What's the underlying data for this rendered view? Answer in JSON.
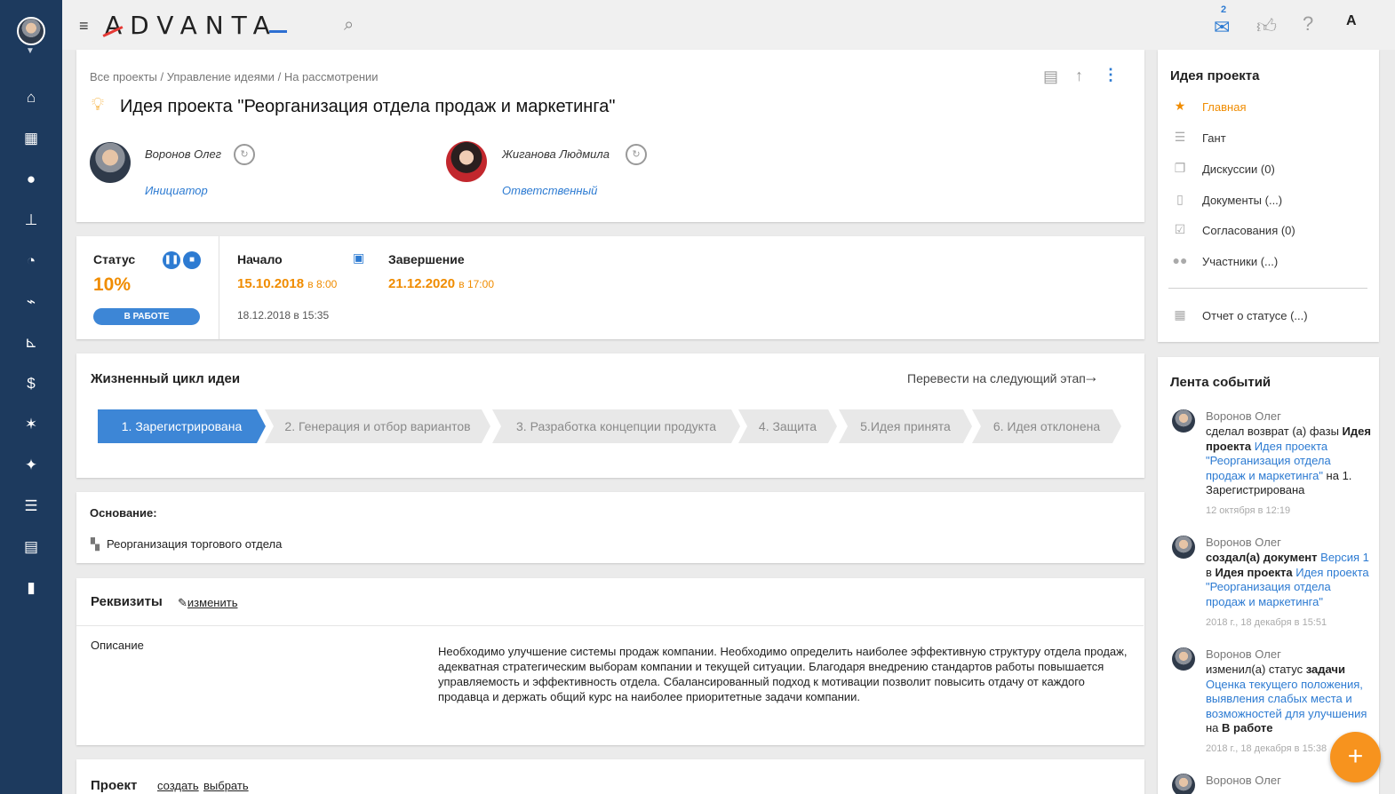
{
  "nav": {
    "icons": [
      "home-icon",
      "calendar-icon",
      "contacts-icon",
      "org-structure-icon",
      "analytics-pie-icon",
      "statistics-icon",
      "reports-icon",
      "finance-icon",
      "activity-icon",
      "ideas-sparkle-icon",
      "tasks-icon",
      "news-icon",
      "bookmark-icon"
    ]
  },
  "topbar": {
    "logo": "ADVANTA",
    "mail_count": "2",
    "user_initial": "A"
  },
  "header": {
    "breadcrumb": [
      {
        "label": "Все проекты"
      },
      {
        "label": "Управление идеями"
      },
      {
        "label": "На рассмотрении"
      }
    ],
    "breadcrumb_sep": "/",
    "title": "Идея проекта \"Реорганизация отдела продаж и маркетинга\"",
    "initiator": {
      "name": "Воронов Олег",
      "role": "Инициатор"
    },
    "responsible": {
      "name": "Жиганова Людмила",
      "role": "Ответственный"
    }
  },
  "status": {
    "label": "Статус",
    "value": "10%",
    "badge": "В РАБОТЕ",
    "start_label": "Начало",
    "start_date": "15.10.2018",
    "start_time": "в 8:00",
    "end_label": "Завершение",
    "end_date": "21.12.2020",
    "end_time": "в 17:00",
    "created": "18.12.2018 в 15:35"
  },
  "lifecycle": {
    "title": "Жизненный цикл идеи",
    "next_label": "Перевести на следующий этап",
    "stages": [
      "1. Зарегистрирована",
      "2. Генерация и отбор вариантов",
      "3. Разработка концепции продукта",
      "4. Защита",
      "5.Идея принята",
      "6. Идея отклонена"
    ],
    "active_index": 0
  },
  "basis": {
    "label": "Основание:",
    "link": "Реорганизация торгового отдела"
  },
  "requisites": {
    "title": "Реквизиты",
    "edit": "изменить",
    "desc_label": "Описание",
    "desc_text": "Необходимо улучшение системы продаж компании. Необходимо определить наиболее эффективную структуру отдела продаж, адекватная стратегическим выборам компании и текущей ситуации. Благодаря внедрению стандартов работы повышается управляемость и эффективность отдела. Сбалансированный подход к мотивации позволит повысить отдачу от каждого продавца и держать общий курс на наиболее приоритетные задачи компании."
  },
  "project": {
    "title": "Проект",
    "create": "создать",
    "choose": "выбрать"
  },
  "right_panel": {
    "title": "Идея проекта",
    "items": [
      {
        "label": "Главная",
        "icon": "star-icon"
      },
      {
        "label": "Гант",
        "icon": "gantt-icon"
      },
      {
        "label": "Дискуссии (0)",
        "icon": "discussions-icon"
      },
      {
        "label": "Документы (...)",
        "icon": "documents-icon"
      },
      {
        "label": "Согласования (0)",
        "icon": "approvals-icon"
      },
      {
        "label": "Участники (...)",
        "icon": "participants-icon"
      }
    ],
    "report": "Отчет о статусе (...)"
  },
  "feed": {
    "title": "Лента событий",
    "items": [
      {
        "author": "Воронов Олег",
        "t1": "сделал возврат (а) фазы ",
        "b1": "Идея проекта",
        "l1": " Идея проекта \"Реорганизация отдела продаж и маркетинга\"",
        "t2": " на 1. Зарегистрирована",
        "time": "12 октября в 12:19"
      },
      {
        "author": "Воронов Олег",
        "b0": "создал(а) документ",
        "l0": " Версия 1",
        "t1": " в ",
        "b1": "Идея проекта",
        "l1": " Идея проекта \"Реорганизация отдела продаж и маркетинга\"",
        "time": "2018 г., 18 декабря в 15:51"
      },
      {
        "author": "Воронов Олег",
        "t1": "изменил(а) статус ",
        "b1": "задачи",
        "l1": " Оценка текущего положения, выявления слабых места и возможностей для улучшения",
        "t2": " на ",
        "b2": "В работе",
        "time": "2018 г., 18 декабря в 15:38"
      },
      {
        "author": "Воронов Олег"
      }
    ]
  },
  "fab": "+"
}
